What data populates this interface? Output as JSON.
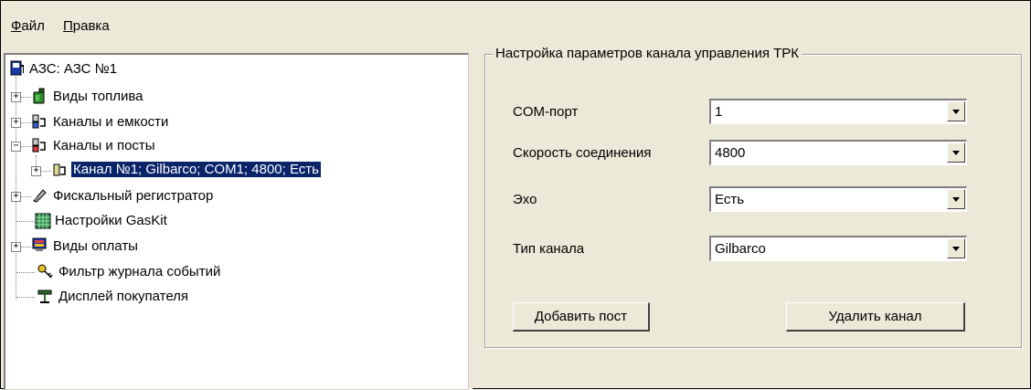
{
  "menu": {
    "file": {
      "accel": "Ф",
      "rest": "айл"
    },
    "edit": {
      "accel": "П",
      "rest": "равка"
    }
  },
  "tree": {
    "root": "АЗС: АЗС №1",
    "items": [
      {
        "label": "Виды топлива",
        "icon": "fuel-can-icon",
        "expander": "+"
      },
      {
        "label": "Каналы и емкости",
        "icon": "tank-channel-icon",
        "expander": "+"
      },
      {
        "label": "Каналы и посты",
        "icon": "channel-posts-icon",
        "expander": "−"
      },
      {
        "label": "Канал №1; Gilbarco; COM1; 4800; Есть",
        "icon": "channel-icon",
        "expander": "+"
      },
      {
        "label": "Фискальный регистратор",
        "icon": "fiscal-register-icon",
        "expander": "+"
      },
      {
        "label": "Настройки GasKit",
        "icon": "grid-settings-icon",
        "expander": ""
      },
      {
        "label": "Виды оплаты",
        "icon": "payment-icon",
        "expander": "+"
      },
      {
        "label": "Фильтр журнала событий",
        "icon": "key-filter-icon",
        "expander": ""
      },
      {
        "label": "Дисплей покупателя",
        "icon": "display-icon",
        "expander": ""
      }
    ]
  },
  "settings": {
    "title": "Настройка параметров канала управления ТРК",
    "com_port": {
      "label": "COM-порт",
      "value": "1"
    },
    "speed": {
      "label": "Скорость соединения",
      "value": "4800"
    },
    "echo": {
      "label": "Эхо",
      "value": "Есть"
    },
    "channel_type": {
      "label": "Тип канала",
      "value": "Gilbarco"
    },
    "add_post_button": "Добавить пост",
    "delete_channel_button": "Удалить канал"
  },
  "colors": {
    "selection": "#0a246a",
    "panel": "#ece9d8"
  }
}
